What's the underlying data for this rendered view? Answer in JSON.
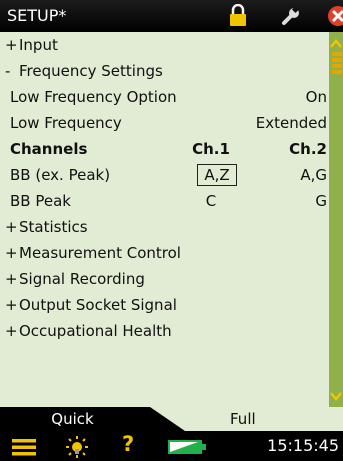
{
  "titlebar": {
    "title": "SETUP*",
    "icons": [
      "lock-icon",
      "wrench-icon",
      "close-icon"
    ]
  },
  "list": {
    "input": {
      "sign": "+",
      "label": "Input"
    },
    "frequency_settings": {
      "sign": "-",
      "label": "Frequency Settings"
    },
    "low_frequency_option": {
      "label": "Low Frequency Option",
      "value": "On"
    },
    "low_frequency": {
      "label": "Low Frequency",
      "value": "Extended"
    },
    "channels": {
      "label": "Channels",
      "ch1": "Ch.1",
      "ch2": "Ch.2"
    },
    "bb_ex_peak": {
      "label": "BB (ex. Peak)",
      "ch1": "A,Z",
      "ch2": "A,G"
    },
    "bb_peak": {
      "label": "BB Peak",
      "ch1": "C",
      "ch2": "G"
    },
    "statistics": {
      "sign": "+",
      "label": "Statistics"
    },
    "measurement_control": {
      "sign": "+",
      "label": "Measurement Control"
    },
    "signal_recording": {
      "sign": "+",
      "label": "Signal Recording"
    },
    "output_socket_signal": {
      "sign": "+",
      "label": "Output Socket Signal"
    },
    "occupational_health": {
      "sign": "+",
      "label": "Occupational Health"
    }
  },
  "tabs": {
    "quick": "Quick",
    "full": "Full",
    "active": "full"
  },
  "statusbar": {
    "icons": [
      "menu-icon",
      "backlight-icon",
      "help-icon",
      "battery-icon"
    ],
    "help": "?",
    "time": "15:15:45"
  },
  "colors": {
    "background": "#e2ebd3",
    "scrollbar": "#8fb04a",
    "accent": "#f2c400",
    "close": "#e0402a"
  }
}
